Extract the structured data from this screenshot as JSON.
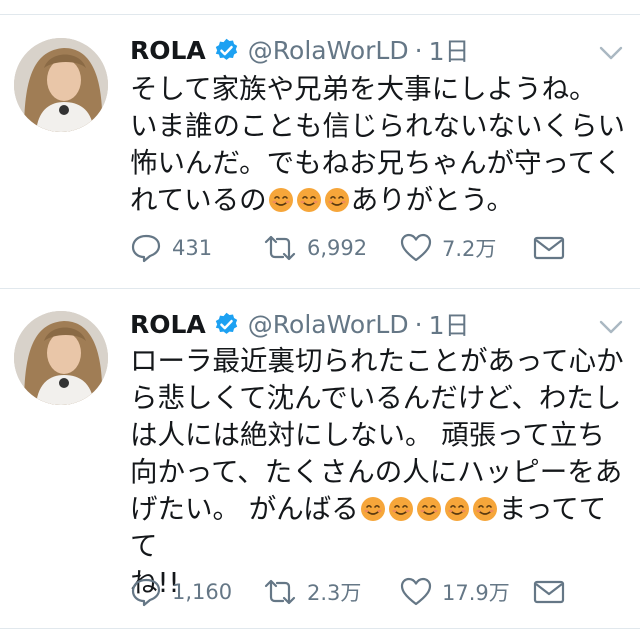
{
  "tweets": [
    {
      "name": "ROLA",
      "handle": "@RolaWorLD",
      "separator": "·",
      "time": "1日",
      "lines": [
        "そして家族や兄弟を大事にしようね。",
        "いま誰のことも信じられないないくらい",
        "怖いんだ。でもねお兄ちゃんが守ってく",
        "れているの",
        "ありがとう。"
      ],
      "replies": "431",
      "retweets": "6,992",
      "likes": "7.2万"
    },
    {
      "name": "ROLA",
      "handle": "@RolaWorLD",
      "separator": "·",
      "time": "1日",
      "lines": [
        "ローラ最近裏切られたことがあって心か",
        "ら悲しくて沈んでいるんだけど、わたし",
        "は人には絶対にしない。 頑張って立ち",
        "向かって、たくさんの人にハッピーをあ",
        "げたい。 がんばる",
        "まっててて",
        "ね!!"
      ],
      "replies": "1,160",
      "retweets": "2.3万",
      "likes": "17.9万"
    }
  ],
  "icons": {
    "reply": "speech-bubble-icon",
    "retweet": "retweet-arrows-icon",
    "like": "heart-outline-icon",
    "dm": "envelope-icon",
    "verified": "verified-badge-icon",
    "emoji": "smiling-face-emoji",
    "more": "chevron-down-icon"
  },
  "colors": {
    "text": "#14171a",
    "secondary": "#657786",
    "verified": "#1da1f2",
    "separator": "#e1e8ed",
    "emoji": "#f6a63a"
  }
}
